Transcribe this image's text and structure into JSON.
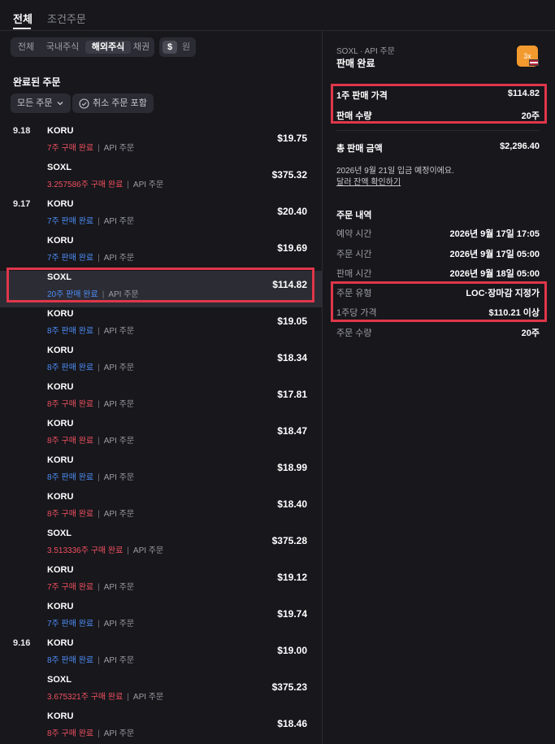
{
  "top_tabs": [
    {
      "label": "전체",
      "active": true
    },
    {
      "label": "조건주문",
      "active": false
    }
  ],
  "filters": {
    "market_segments": [
      "전체",
      "국내주식",
      "해외주식",
      "채권"
    ],
    "active_segment": "해외주식",
    "currency": [
      "$",
      "원"
    ],
    "active_currency": "$"
  },
  "section_title": "완료된 주문",
  "filter_buttons": {
    "order_type": "모든 주문",
    "include_cancelled": "취소 주문 포함"
  },
  "orders": [
    {
      "date": "9.18",
      "symbol": "KORU",
      "qty": "7주",
      "action": "구매 완료",
      "side": "buy",
      "channel": "API 주문",
      "amount": "$19.75"
    },
    {
      "date": "",
      "symbol": "SOXL",
      "qty": "3.257586주",
      "action": "구매 완료",
      "side": "buy",
      "channel": "API 주문",
      "amount": "$375.32"
    },
    {
      "date": "9.17",
      "symbol": "KORU",
      "qty": "7주",
      "action": "판매 완료",
      "side": "sell",
      "channel": "API 주문",
      "amount": "$20.40"
    },
    {
      "date": "",
      "symbol": "KORU",
      "qty": "7주",
      "action": "판매 완료",
      "side": "sell",
      "channel": "API 주문",
      "amount": "$19.69"
    },
    {
      "date": "",
      "symbol": "SOXL",
      "qty": "20주",
      "action": "판매 완료",
      "side": "sell",
      "channel": "API 주문",
      "amount": "$114.82",
      "selected": true
    },
    {
      "date": "",
      "symbol": "KORU",
      "qty": "8주",
      "action": "판매 완료",
      "side": "sell",
      "channel": "API 주문",
      "amount": "$19.05"
    },
    {
      "date": "",
      "symbol": "KORU",
      "qty": "8주",
      "action": "판매 완료",
      "side": "sell",
      "channel": "API 주문",
      "amount": "$18.34"
    },
    {
      "date": "",
      "symbol": "KORU",
      "qty": "8주",
      "action": "구매 완료",
      "side": "buy",
      "channel": "API 주문",
      "amount": "$17.81"
    },
    {
      "date": "",
      "symbol": "KORU",
      "qty": "8주",
      "action": "구매 완료",
      "side": "buy",
      "channel": "API 주문",
      "amount": "$18.47"
    },
    {
      "date": "",
      "symbol": "KORU",
      "qty": "8주",
      "action": "판매 완료",
      "side": "sell",
      "channel": "API 주문",
      "amount": "$18.99"
    },
    {
      "date": "",
      "symbol": "KORU",
      "qty": "8주",
      "action": "구매 완료",
      "side": "buy",
      "channel": "API 주문",
      "amount": "$18.40"
    },
    {
      "date": "",
      "symbol": "SOXL",
      "qty": "3.513336주",
      "action": "구매 완료",
      "side": "buy",
      "channel": "API 주문",
      "amount": "$375.28"
    },
    {
      "date": "",
      "symbol": "KORU",
      "qty": "7주",
      "action": "구매 완료",
      "side": "buy",
      "channel": "API 주문",
      "amount": "$19.12"
    },
    {
      "date": "",
      "symbol": "KORU",
      "qty": "7주",
      "action": "판매 완료",
      "side": "sell",
      "channel": "API 주문",
      "amount": "$19.74"
    },
    {
      "date": "9.16",
      "symbol": "KORU",
      "qty": "8주",
      "action": "판매 완료",
      "side": "sell",
      "channel": "API 주문",
      "amount": "$19.00"
    },
    {
      "date": "",
      "symbol": "SOXL",
      "qty": "3.675321주",
      "action": "구매 완료",
      "side": "buy",
      "channel": "API 주문",
      "amount": "$375.23"
    },
    {
      "date": "",
      "symbol": "KORU",
      "qty": "8주",
      "action": "구매 완료",
      "side": "buy",
      "channel": "API 주문",
      "amount": "$18.46"
    }
  ],
  "detail": {
    "meta": "SOXL · API 주문",
    "status": "판매 완료",
    "badge": "3x",
    "unit_price_label": "1주 판매 가격",
    "unit_price_value": "$114.82",
    "qty_label": "판매 수량",
    "qty_value": "20주",
    "total_label": "총 판매 금액",
    "total_value": "$2,296.40",
    "note": "2026년 9월 21일 입금 예정이에요.",
    "link": "달러 잔액 확인하기",
    "section": "주문 내역",
    "rows": [
      {
        "label": "예약 시간",
        "value": "2026년 9월 17일 17:05"
      },
      {
        "label": "주문 시간",
        "value": "2026년 9월 17일 05:00"
      },
      {
        "label": "판매 시간",
        "value": "2026년 9월 18일 05:00"
      },
      {
        "label": "주문 유형",
        "value": "LOC·장마감 지정가"
      },
      {
        "label": "1주당 가격",
        "value": "$110.21 이상"
      },
      {
        "label": "주문 수량",
        "value": "20주"
      }
    ]
  },
  "colors": {
    "background": "#17171c",
    "buy": "#f0505f",
    "sell": "#4e8df5",
    "highlight": "#e0364a",
    "badge": "#f29a2e"
  }
}
